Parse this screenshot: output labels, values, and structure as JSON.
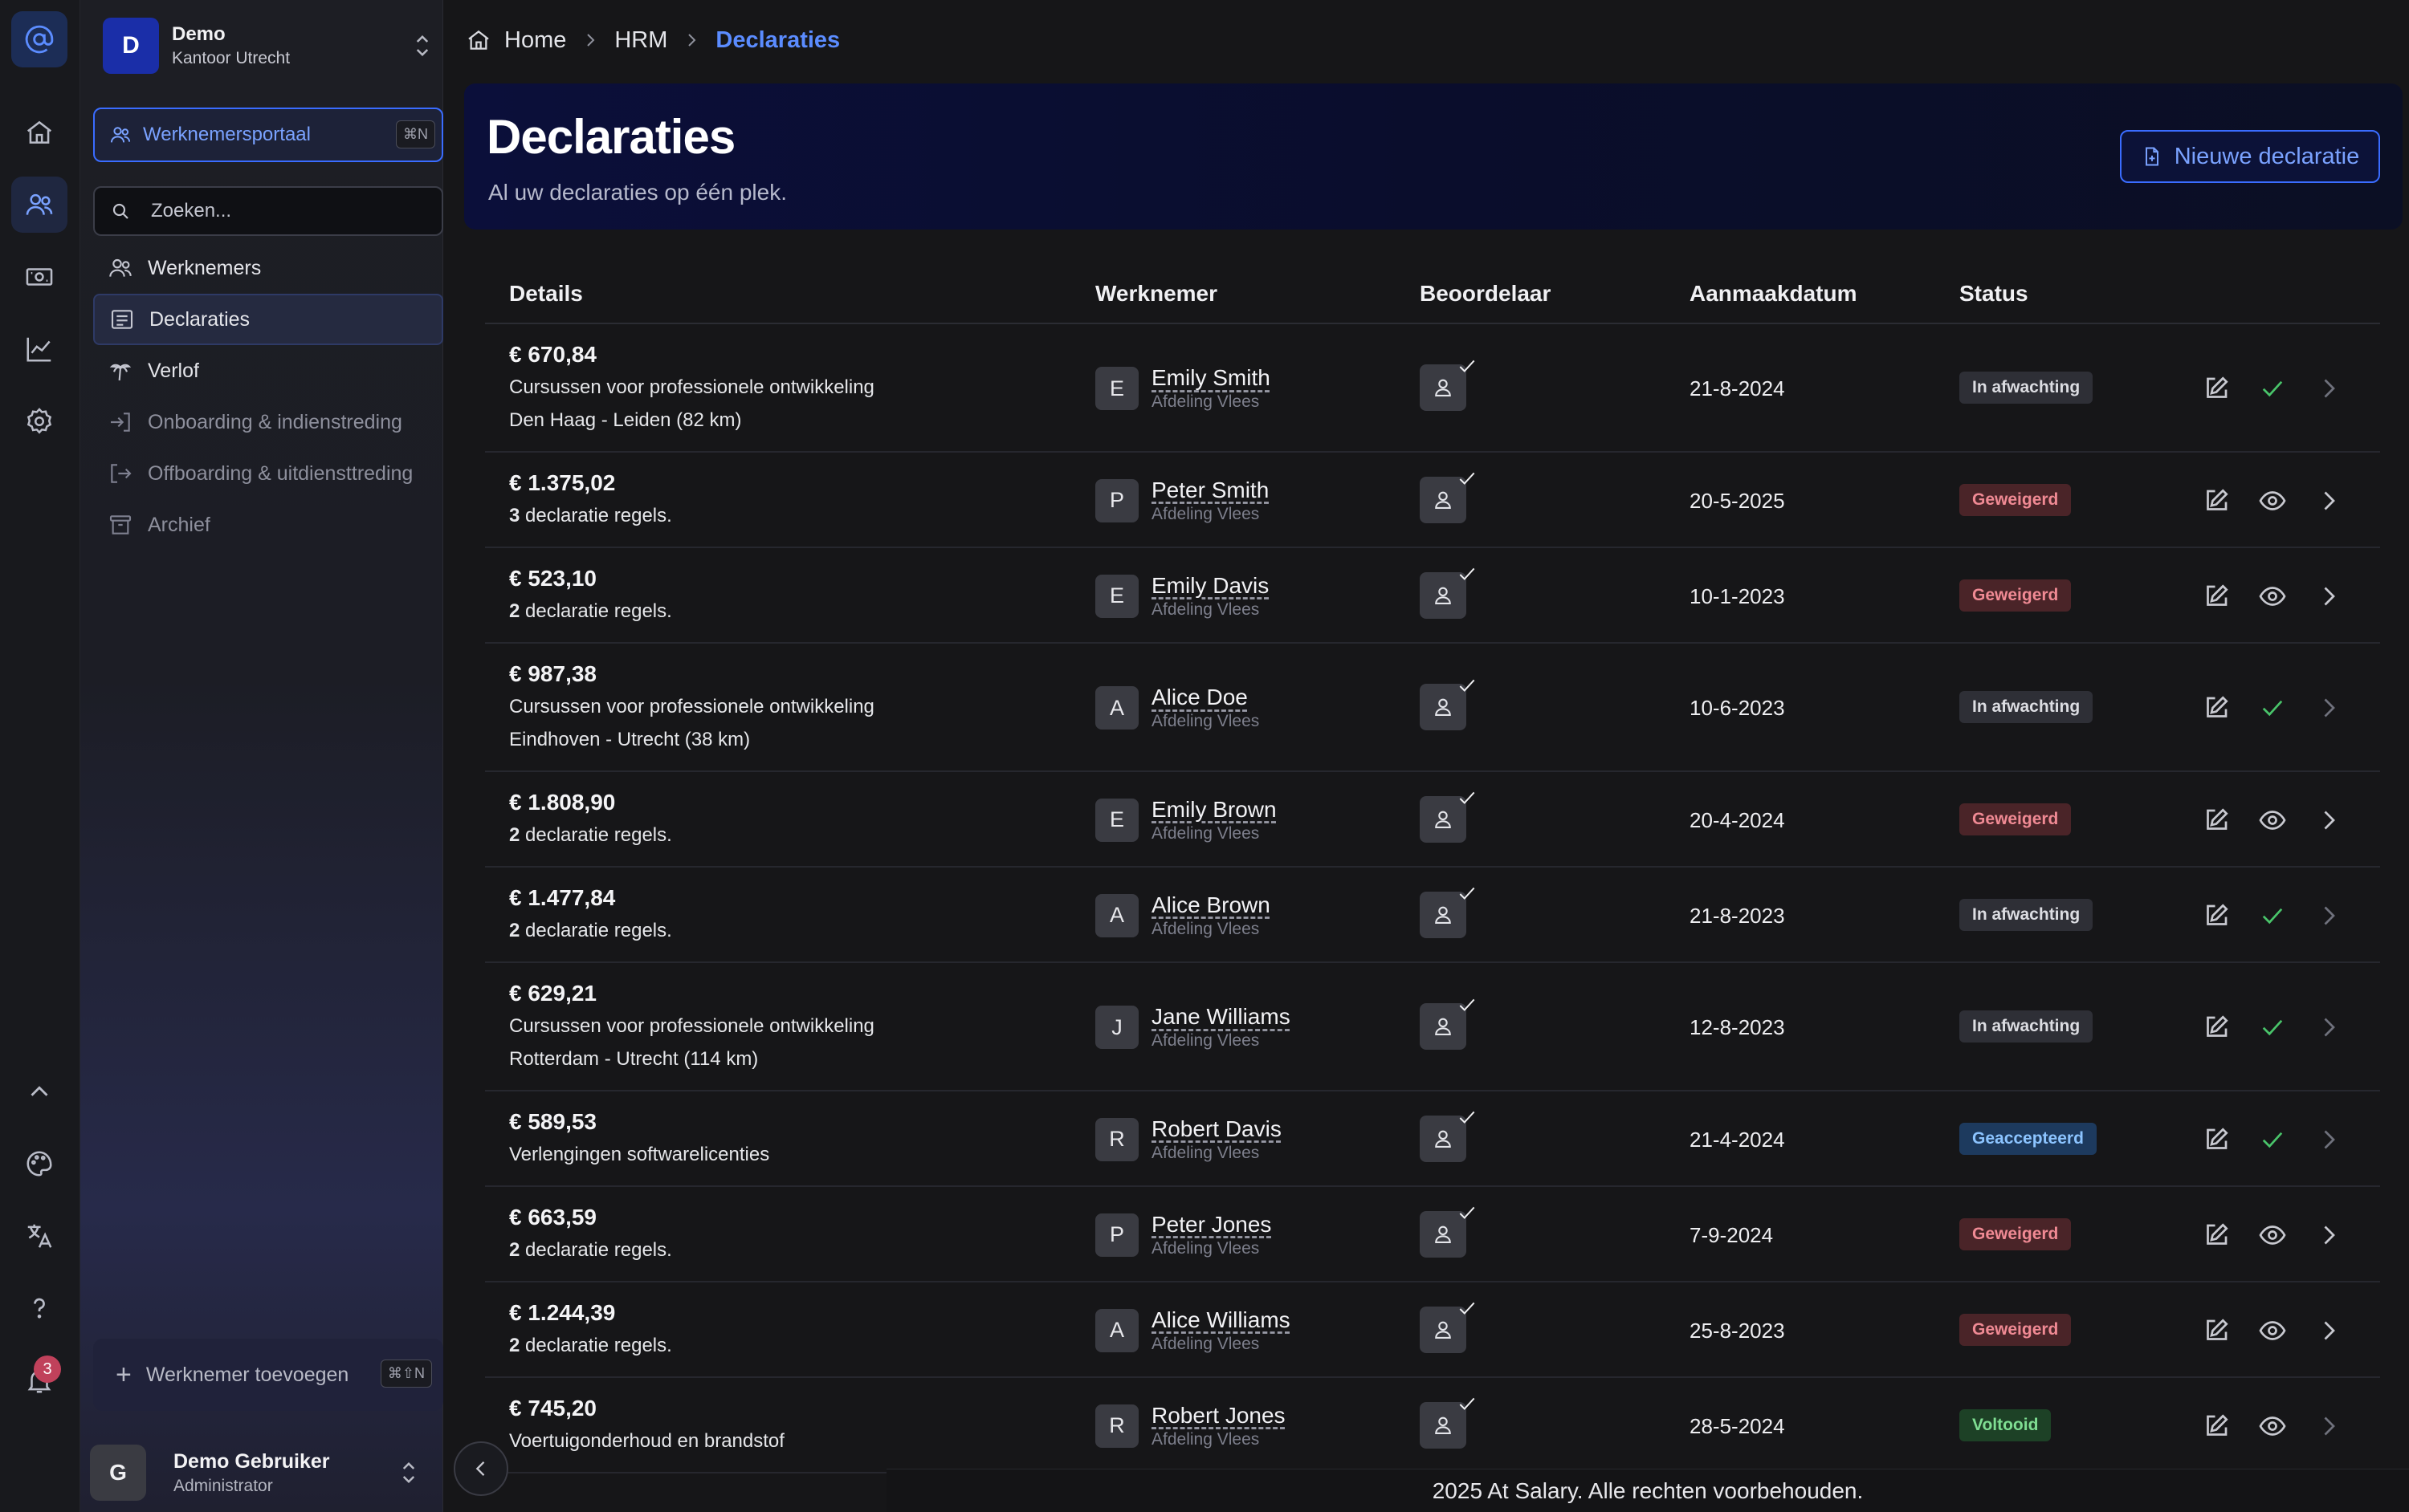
{
  "org": {
    "initial": "D",
    "name": "Demo",
    "office": "Kantoor Utrecht"
  },
  "sidebar": {
    "portal_label": "Werknemersportaal",
    "portal_shortcut": "⌘N",
    "search_placeholder": "Zoeken...",
    "items": [
      {
        "label": "Werknemers",
        "icon": "users-icon"
      },
      {
        "label": "Declaraties",
        "icon": "receipt-icon",
        "active": true
      },
      {
        "label": "Verlof",
        "icon": "palm-tree-icon"
      },
      {
        "label": "Onboarding & indienstreding",
        "icon": "sign-in-icon",
        "muted": true
      },
      {
        "label": "Offboarding & uitdiensttreding",
        "icon": "sign-out-icon",
        "muted": true
      },
      {
        "label": "Archief",
        "icon": "archive-icon",
        "muted": true
      }
    ],
    "add_employee_label": "Werknemer toevoegen",
    "add_employee_shortcut": "⌘⇧N"
  },
  "rail": {
    "notification_count": "3"
  },
  "user": {
    "initial": "G",
    "name": "Demo Gebruiker",
    "role": "Administrator"
  },
  "breadcrumb": {
    "home": "Home",
    "section": "HRM",
    "current": "Declaraties"
  },
  "page": {
    "title": "Declaraties",
    "subtitle": "Al uw declaraties op één plek.",
    "new_button": "Nieuwe declaratie"
  },
  "table": {
    "headers": {
      "details": "Details",
      "employee": "Werknemer",
      "reviewer": "Beoordelaar",
      "created": "Aanmaakdatum",
      "status": "Status"
    },
    "rows": [
      {
        "amount": "€ 670,84",
        "line1": "Cursussen voor professionele ontwikkeling",
        "line2": "Den Haag - Leiden (82 km)",
        "initial": "E",
        "name": "Emily Smith",
        "dept": "Afdeling Vlees",
        "date": "21-8-2024",
        "status": "In afwachting",
        "status_type": "pending",
        "action": "approve"
      },
      {
        "amount": "€ 1.375,02",
        "count": "3",
        "line1": " declaratie regels.",
        "initial": "P",
        "name": "Peter Smith",
        "dept": "Afdeling Vlees",
        "date": "20-5-2025",
        "status": "Geweigerd",
        "status_type": "rejected",
        "action": "view"
      },
      {
        "amount": "€ 523,10",
        "count": "2",
        "line1": " declaratie regels.",
        "initial": "E",
        "name": "Emily Davis",
        "dept": "Afdeling Vlees",
        "date": "10-1-2023",
        "status": "Geweigerd",
        "status_type": "rejected",
        "action": "view"
      },
      {
        "amount": "€ 987,38",
        "line1": "Cursussen voor professionele ontwikkeling",
        "line2": "Eindhoven - Utrecht (38 km)",
        "initial": "A",
        "name": "Alice Doe",
        "dept": "Afdeling Vlees",
        "date": "10-6-2023",
        "status": "In afwachting",
        "status_type": "pending",
        "action": "approve"
      },
      {
        "amount": "€ 1.808,90",
        "count": "2",
        "line1": " declaratie regels.",
        "initial": "E",
        "name": "Emily Brown",
        "dept": "Afdeling Vlees",
        "date": "20-4-2024",
        "status": "Geweigerd",
        "status_type": "rejected",
        "action": "view"
      },
      {
        "amount": "€ 1.477,84",
        "count": "2",
        "line1": " declaratie regels.",
        "initial": "A",
        "name": "Alice Brown",
        "dept": "Afdeling Vlees",
        "date": "21-8-2023",
        "status": "In afwachting",
        "status_type": "pending",
        "action": "approve"
      },
      {
        "amount": "€ 629,21",
        "line1": "Cursussen voor professionele ontwikkeling",
        "line2": "Rotterdam - Utrecht (114 km)",
        "initial": "J",
        "name": "Jane Williams",
        "dept": "Afdeling Vlees",
        "date": "12-8-2023",
        "status": "In afwachting",
        "status_type": "pending",
        "action": "approve"
      },
      {
        "amount": "€ 589,53",
        "line1": "Verlengingen softwarelicenties",
        "initial": "R",
        "name": "Robert Davis",
        "dept": "Afdeling Vlees",
        "date": "21-4-2024",
        "status": "Geaccepteerd",
        "status_type": "accepted",
        "action": "approve"
      },
      {
        "amount": "€ 663,59",
        "count": "2",
        "line1": " declaratie regels.",
        "initial": "P",
        "name": "Peter Jones",
        "dept": "Afdeling Vlees",
        "date": "7-9-2024",
        "status": "Geweigerd",
        "status_type": "rejected",
        "action": "view"
      },
      {
        "amount": "€ 1.244,39",
        "count": "2",
        "line1": " declaratie regels.",
        "initial": "A",
        "name": "Alice Williams",
        "dept": "Afdeling Vlees",
        "date": "25-8-2023",
        "status": "Geweigerd",
        "status_type": "rejected",
        "action": "view"
      },
      {
        "amount": "€ 745,20",
        "line1": "Voertuigonderhoud en brandstof",
        "initial": "R",
        "name": "Robert Jones",
        "dept": "Afdeling Vlees",
        "date": "28-5-2024",
        "status": "Voltooid",
        "status_type": "done",
        "action": "view"
      }
    ]
  },
  "footer": {
    "text": "2025 At Salary. Alle rechten voorbehouden."
  }
}
